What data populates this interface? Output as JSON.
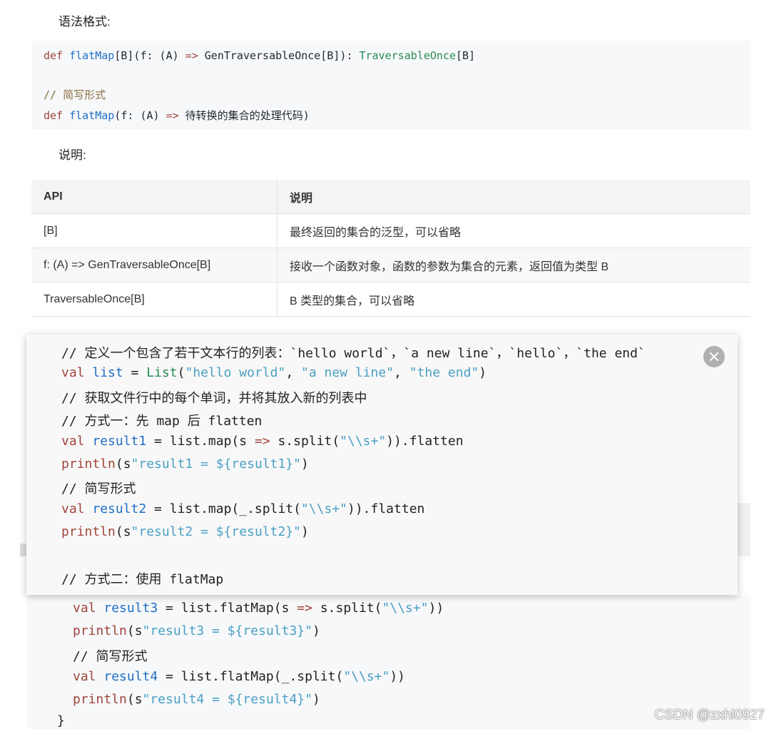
{
  "labels": {
    "syntax": "语法格式:",
    "explain": "说明:"
  },
  "syntax_code": {
    "line1": {
      "def": "def",
      "name": "flatMap",
      "rest1": "[B](f: (A) ",
      "arrow": "=>",
      "rest2": " GenTraversableOnce[B]): ",
      "ret": "TraversableOnce",
      "rest3": "[B]"
    },
    "comment": "// 简写形式",
    "line2": {
      "def": "def",
      "name": "flatMap",
      "rest1": "(f: (A) ",
      "arrow": "=>",
      "rest2": " 待转换的集合的处理代码)"
    }
  },
  "table": {
    "headers": [
      "API",
      "说明"
    ],
    "rows": [
      [
        "[B]",
        "最终返回的集合的泛型，可以省略"
      ],
      [
        "f: (A) => GenTraversableOnce[B]",
        "接收一个函数对象，函数的参数为集合的元素，返回值为类型 B"
      ],
      [
        "TraversableOnce[B]",
        "B 类型的集合，可以省略"
      ]
    ]
  },
  "popup": {
    "l1": "// 定义一个包含了若干文本行的列表：`hello world`，`a new line`，`hello`，`the end`",
    "l2": {
      "val": "val",
      "var": "list",
      "eq": " = ",
      "type": "List",
      "open": "(",
      "s1": "\"hello world\"",
      "c1": ", ",
      "s2": "\"a new line\"",
      "c2": ", ",
      "s3": "\"the end\"",
      "close": ")"
    },
    "l3": "// 获取文件行中的每个单词，并将其放入新的列表中",
    "l4": "// 方式一：先 map 后 flatten",
    "l5": {
      "val": "val",
      "var": "result1",
      "pre": " = list.map(s ",
      "arrow": "=>",
      "mid": " s.split(",
      "str": "\"\\\\s+\"",
      "post": ")).flatten"
    },
    "l6": {
      "fn": "println",
      "open": "(s",
      "str": "\"result1 = ${result1}\"",
      "close": ")"
    },
    "l7": "// 简写形式",
    "l8": {
      "val": "val",
      "var": "result2",
      "pre": " = list.map(_.split(",
      "str": "\"\\\\s+\"",
      "post": ")).flatten"
    },
    "l9": {
      "fn": "println",
      "open": "(s",
      "str": "\"result2 = ${result2}\"",
      "close": ")"
    },
    "l10": "// 方式二：使用 flatMap"
  },
  "behind": {
    "l1": {
      "val": "val",
      "var": "result3",
      "pre": " = list.flatMap(s ",
      "arrow": "=>",
      "mid": " s.split(",
      "str": "\"\\\\s+\"",
      "post": "))"
    },
    "l2": {
      "fn": "println",
      "open": "(s",
      "str": "\"result3 = ${result3}\"",
      "close": ")"
    },
    "l3": "// 简写形式",
    "l4": {
      "val": "val",
      "var": "result4",
      "pre": " = list.flatMap(_.split(",
      "str": "\"\\\\s+\"",
      "post": "))"
    },
    "l5": {
      "fn": "println",
      "open": "(s",
      "str": "\"result4 = ${result4}\"",
      "close": ")"
    },
    "l6": "}"
  },
  "watermark": "CSDN @zxhl0927",
  "icons": {
    "close": "close-icon"
  }
}
